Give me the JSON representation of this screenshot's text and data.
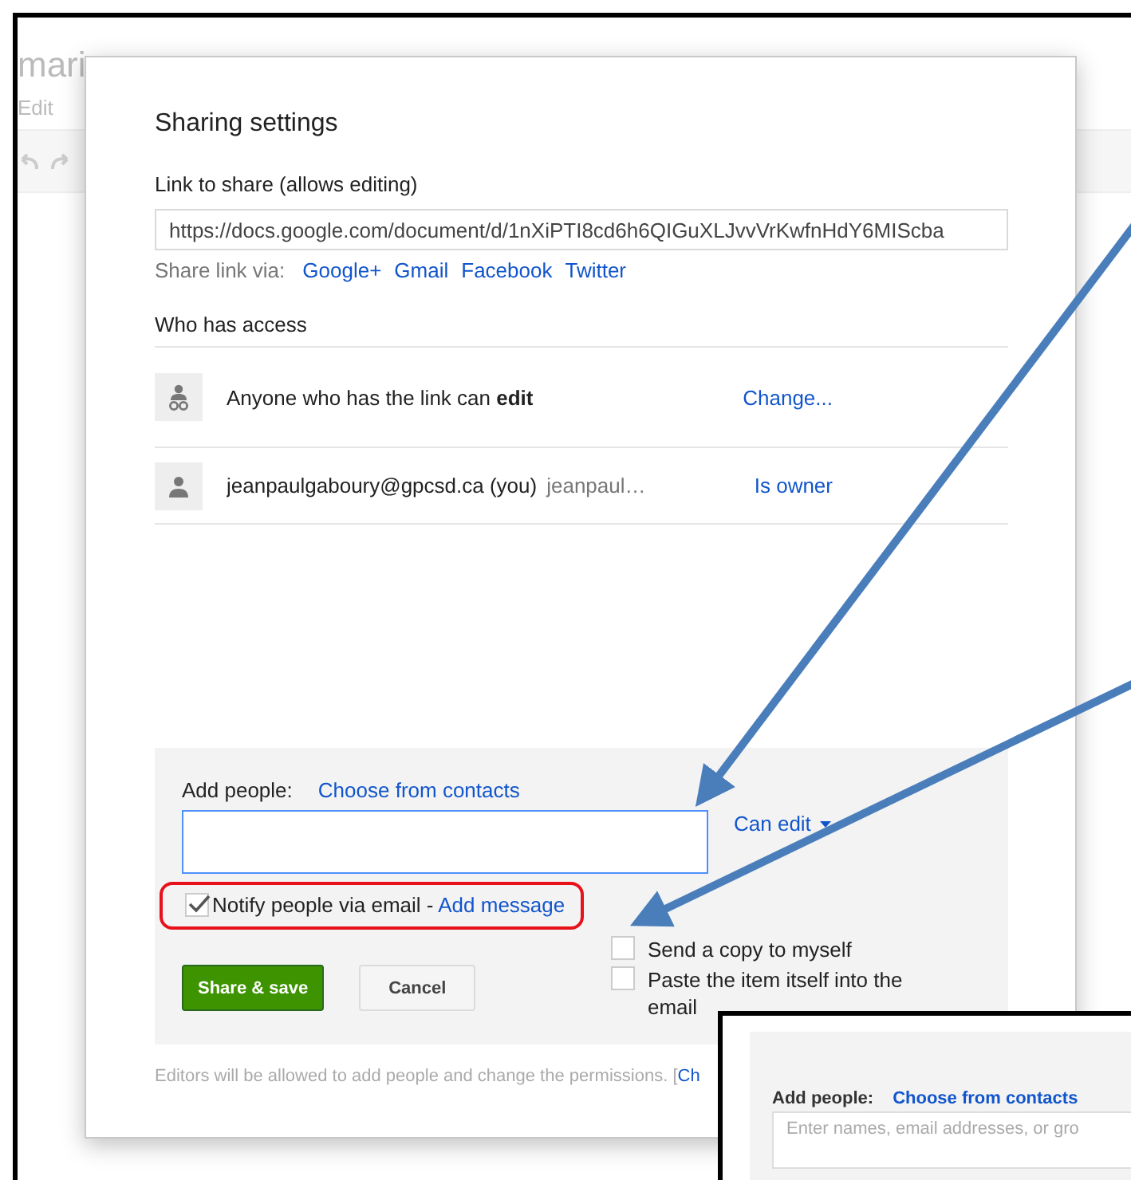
{
  "background_document": {
    "title": "mari",
    "menu": [
      "Edit"
    ]
  },
  "dialog": {
    "title": "Sharing settings",
    "link_label": "Link to share (allows editing)",
    "link_value": "https://docs.google.com/document/d/1nXiPTI8cd6h6QIGuXLJvvVrKwfnHdY6MIScba",
    "share_via_label": "Share link via:",
    "share_via": [
      "Google+",
      "Gmail",
      "Facebook",
      "Twitter"
    ],
    "access_heading": "Who has access",
    "access": [
      {
        "kind": "link",
        "text_before": "Anyone who has the link can ",
        "text_bold": "edit",
        "action": "Change..."
      },
      {
        "kind": "person",
        "text_before": "jeanpaulgaboury@gpcsd.ca (you)",
        "detail": "jeanpaul…",
        "action": "Is owner"
      }
    ],
    "add_people_label": "Add people:",
    "choose_contacts": "Choose from contacts",
    "permission": "Can edit",
    "notify": {
      "label": "Notify people via email - ",
      "checked": true,
      "highlighted": true
    },
    "add_message": "Add message",
    "options": [
      {
        "label": "Send a copy to myself",
        "checked": false
      },
      {
        "label": "Paste the item itself into the email",
        "checked": false
      }
    ],
    "buttons": [
      "Share & save",
      "Cancel"
    ],
    "footer": "Editors will be allowed to add people and change the permissions. [",
    "footer_link": "Ch"
  },
  "inset": {
    "add_people_label": "Add people:",
    "choose_contacts": "Choose from contacts",
    "placeholder": "Enter names, email addresses, or gro"
  }
}
